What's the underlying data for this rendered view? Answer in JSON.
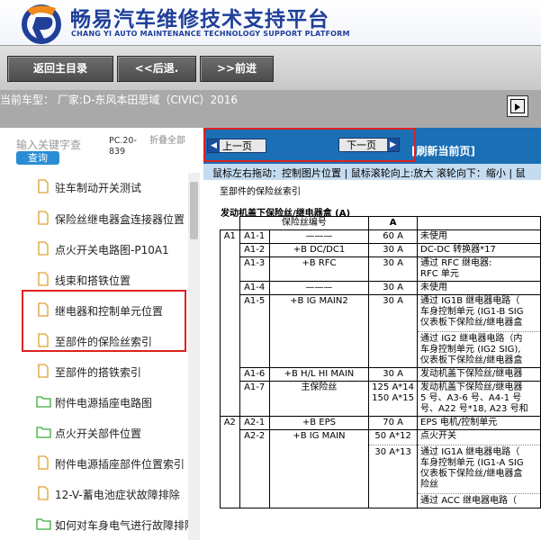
{
  "header": {
    "title": "畅易汽车维修技术支持平台",
    "subtitle": "CHANG YI AUTO MAINTENANCE TECHNOLOGY SUPPORT PLATFORM"
  },
  "toolbar": {
    "home_label": "返回主目录",
    "back_label": "<<后退.",
    "forward_label": ">>前进"
  },
  "vehicle": {
    "text": "当前车型：  厂家:D-东风本田思域（CIVIC）2016"
  },
  "search": {
    "placeholder": "输入关键字查",
    "button": "查询",
    "pc_label": "PC.20-839",
    "fold_label": "折叠全部"
  },
  "tree": {
    "items": [
      {
        "label": "驻车制动开关测试",
        "icon": "document-icon"
      },
      {
        "label": "保险丝继电器盒连接器位置",
        "icon": "document-icon"
      },
      {
        "label": "点火开关电路图-P10A1",
        "icon": "document-icon"
      },
      {
        "label": "线束和搭铁位置",
        "icon": "document-icon"
      },
      {
        "label": "继电器和控制单元位置",
        "icon": "document-icon"
      },
      {
        "label": "至部件的保险丝索引",
        "icon": "document-icon"
      },
      {
        "label": "至部件的搭铁索引",
        "icon": "document-icon"
      },
      {
        "label": "附件电源插座电路图",
        "icon": "folder-icon"
      },
      {
        "label": "点火开关部件位置",
        "icon": "folder-icon"
      },
      {
        "label": "附件电源插座部件位置索引",
        "icon": "document-icon"
      },
      {
        "label": "12-V-蓄电池症状故障排除",
        "icon": "document-icon"
      },
      {
        "label": "如何对车身电气进行故障排除",
        "icon": "folder-icon"
      }
    ]
  },
  "viewer": {
    "prev_label": "上一页",
    "next_label": "下一页",
    "refresh_label": "[刷新当前页]",
    "hint": "鼠标左右拖动：控制图片位置 | 鼠标滚轮向上:放大  滚轮向下：缩小 | 鼠"
  },
  "document": {
    "title": "至部件的保险丝索引",
    "subtitle": "发动机盖下保险丝/继电器盒 (A)",
    "header_fuse": "保险丝编号",
    "header_amp": "A",
    "rows": [
      {
        "g": "A1",
        "no": "A1-1",
        "name": "———",
        "amp": "60 A",
        "desc": "未使用"
      },
      {
        "g": "",
        "no": "A1-2",
        "name": "+B DC/DC1",
        "amp": "30 A",
        "desc": "DC-DC 转换器*17"
      },
      {
        "g": "",
        "no": "A1-3",
        "name": "+B RFC",
        "amp": "30 A",
        "desc": "通过 RFC 继电器:",
        "desc2": "RFC 单元"
      },
      {
        "g": "",
        "no": "A1-4",
        "name": "———",
        "amp": "30 A",
        "desc": "未使用"
      },
      {
        "g": "",
        "no": "A1-5",
        "name": "+B IG MAIN2",
        "amp": "30 A",
        "desc": "通过 IG1B 继电器电路（",
        "desc2": "车身控制单元 (IG1-B SIG",
        "desc3": "仪表板下保险丝/继电器盒",
        "desc4": "通过 IG2 继电器电路（内",
        "desc5": "车身控制单元 (IG2 SIG),",
        "desc6": "仪表板下保险丝/继电器盒"
      },
      {
        "g": "",
        "no": "A1-6",
        "name": "+B H/L HI MAIN",
        "amp": "30 A",
        "desc": "发动机盖下保险丝/继电器"
      },
      {
        "g": "",
        "no": "A1-7",
        "name": "主保险丝",
        "amp": "125 A*14",
        "amp2": "150 A*15",
        "desc": "发动机盖下保险丝/继电器",
        "desc2": "5 号、A3-6 号、A4-1 号",
        "desc3": "号、A22 号*18, A23 号和"
      },
      {
        "g": "A2",
        "no": "A2-1",
        "name": "+B EPS",
        "amp": "70 A",
        "desc": "EPS 电机/控制单元"
      },
      {
        "g": "",
        "no": "A2-2",
        "name": "+B IG MAIN",
        "amp": "50 A*12",
        "amp2": "30 A*13",
        "desc": "点火开关",
        "desc2": "通过 IG1A 继电器电路（",
        "desc3": "车身控制单元 (IG1-A SIG",
        "desc4": "仪表板下保险丝/继电器盒",
        "desc5": "险丝",
        "desc6": "通过 ACC 继电器电路（"
      }
    ]
  },
  "colors": {
    "accent_blue": "#1a6fb5",
    "highlight_red": "#e02020",
    "search_button": "#2a8dd4"
  }
}
